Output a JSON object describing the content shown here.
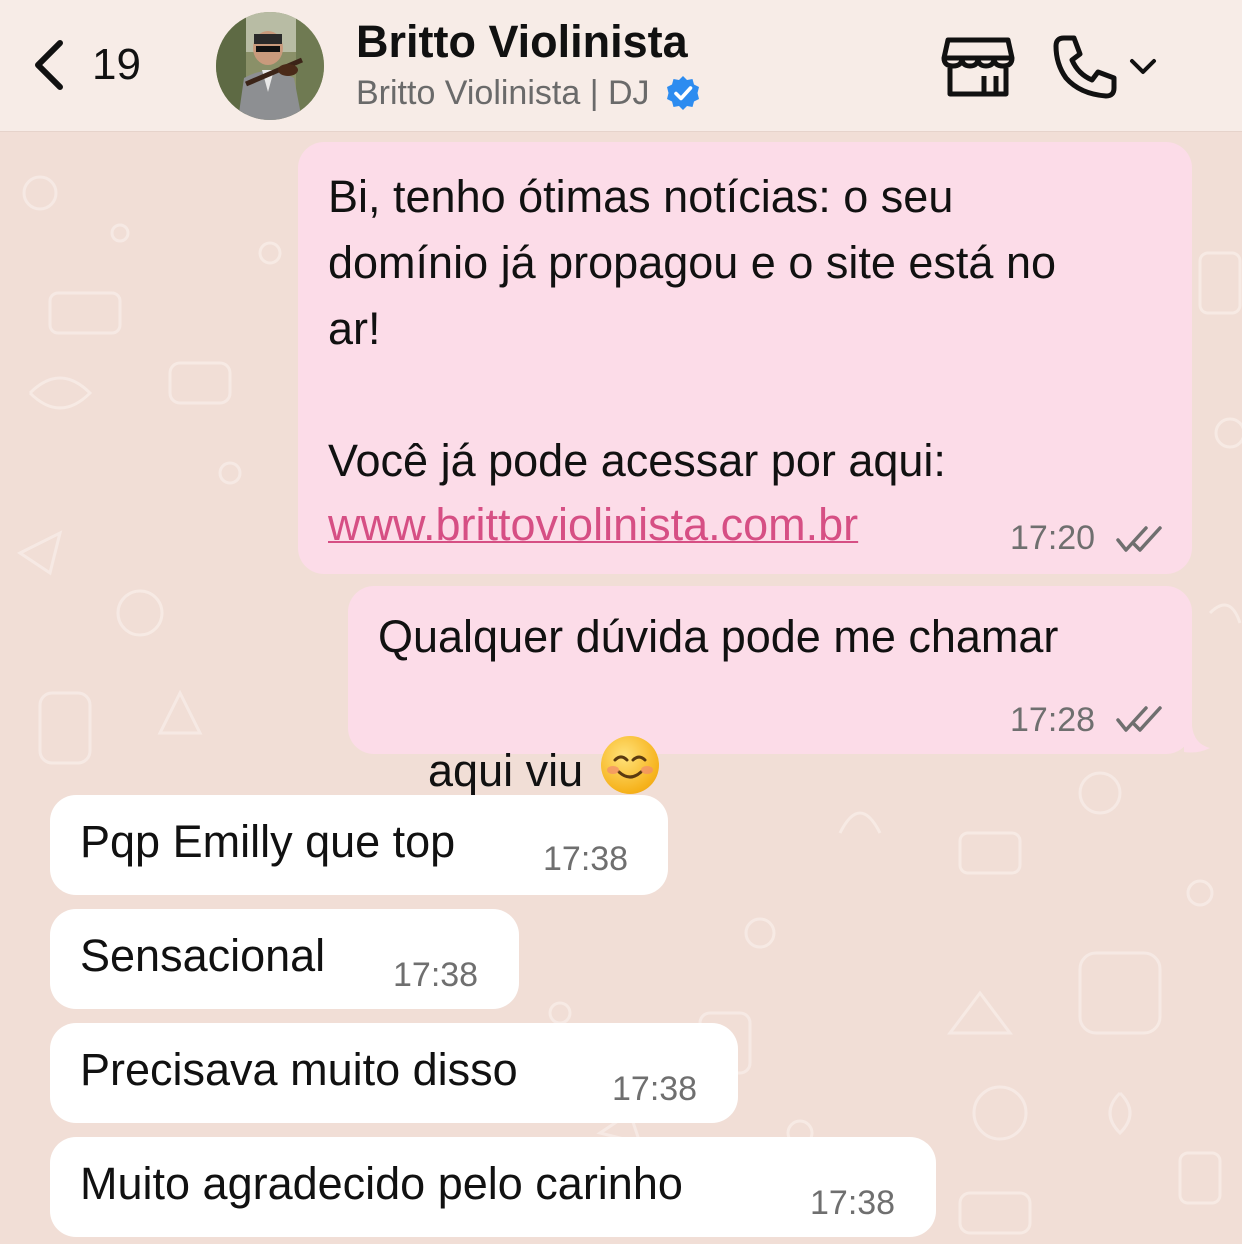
{
  "header": {
    "back_count": "19",
    "title": "Britto Violinista",
    "subtitle": "Britto Violinista | DJ",
    "icons": {
      "back": "chevron-left-icon",
      "verified": "verified-badge-icon",
      "store": "storefront-icon",
      "call": "phone-icon",
      "dropdown": "chevron-down-icon"
    }
  },
  "colors": {
    "header_bg": "#f7ece7",
    "chat_bg": "#f1ded6",
    "outgoing_bubble": "#fcdce8",
    "incoming_bubble": "#ffffff",
    "link": "#d64f84",
    "verified": "#2d8cf0"
  },
  "messages": [
    {
      "direction": "outgoing",
      "lines": [
        "Bi, tenho ótimas notícias: o seu",
        "domínio já propagou e o site está no",
        "ar!",
        "",
        "Você já pode acessar por aqui:"
      ],
      "link": "www.brittoviolinista.com.br",
      "time": "17:20",
      "status": "read-double-check-icon"
    },
    {
      "direction": "outgoing",
      "lines": [
        "Qualquer dúvida pode me chamar",
        "aqui viu"
      ],
      "emoji": "smiling-face-icon",
      "time": "17:28",
      "status": "read-double-check-icon"
    },
    {
      "direction": "incoming",
      "text": "Pqp Emilly que top",
      "time": "17:38"
    },
    {
      "direction": "incoming",
      "text": "Sensacional",
      "time": "17:38"
    },
    {
      "direction": "incoming",
      "text": "Precisava muito disso",
      "time": "17:38"
    },
    {
      "direction": "incoming",
      "text": "Muito agradecido pelo carinho",
      "time": "17:38"
    }
  ]
}
